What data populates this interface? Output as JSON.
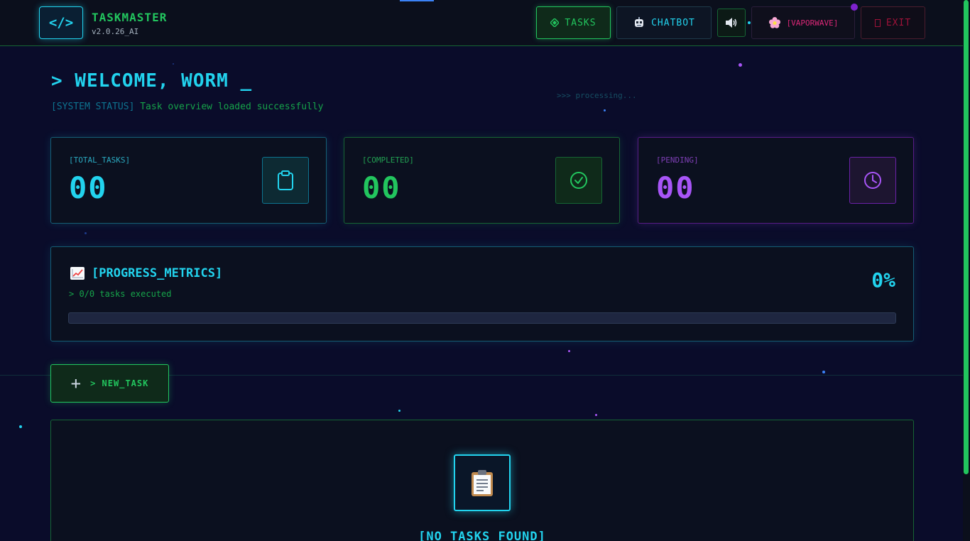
{
  "app": {
    "logo_glyph": "</>",
    "title": "TASKMASTER",
    "version": "v2.0.26_AI"
  },
  "nav": {
    "tasks_label": "TASKS",
    "chatbot_label": "CHATBOT",
    "sound_icon": "speaker-icon",
    "theme_label": "[VAPORWAVE]",
    "exit_label": "EXIT"
  },
  "welcome": {
    "heading": "> WELCOME, WORM _",
    "status_tag": "[SYSTEM STATUS]",
    "status_text": " Task overview loaded successfully",
    "processing": ">>> processing..."
  },
  "stats": {
    "total": {
      "label": "[TOTAL_TASKS]",
      "value": "00",
      "icon": "clipboard-icon",
      "color": "#22d3ee"
    },
    "completed": {
      "label": "[COMPLETED]",
      "value": "00",
      "icon": "check-circle-icon",
      "color": "#22c55e"
    },
    "pending": {
      "label": "[PENDING]",
      "value": "00",
      "icon": "clock-icon",
      "color": "#a855f7"
    }
  },
  "progress": {
    "title": "[PROGRESS_METRICS]",
    "subtitle": "> 0/0 tasks executed",
    "percent_label": "0%",
    "fraction": 0
  },
  "actions": {
    "new_task_label": "> NEW_TASK"
  },
  "empty_state": {
    "icon": "clipboard-document-icon",
    "text": "[NO TASKS FOUND]"
  },
  "colors": {
    "background": "#0a0c2a",
    "cyan": "#22d3ee",
    "green": "#22c55e",
    "purple": "#a855f7",
    "pink": "#db2777"
  }
}
